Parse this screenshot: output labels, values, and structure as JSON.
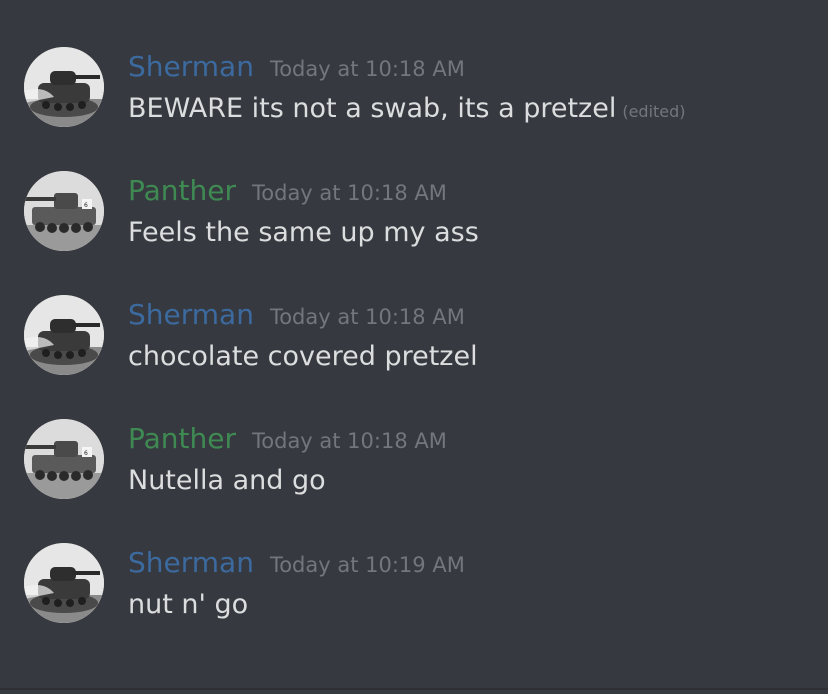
{
  "messages": [
    {
      "author": "Sherman",
      "time": "Today at 10:18 AM",
      "text": "BEWARE its not a swab, its a pretzel",
      "edited": "(edited)",
      "color": "#3c6a9e"
    },
    {
      "author": "Panther",
      "time": "Today at 10:18 AM",
      "text": "Feels the same up my ass",
      "color": "#3f8a52"
    },
    {
      "author": "Sherman",
      "time": "Today at 10:18 AM",
      "text": "chocolate covered pretzel",
      "color": "#3c6a9e"
    },
    {
      "author": "Panther",
      "time": "Today at 10:18 AM",
      "text": "Nutella and go",
      "color": "#3f8a52"
    },
    {
      "author": "Sherman",
      "time": "Today at 10:19 AM",
      "text": "nut n' go",
      "color": "#3c6a9e"
    }
  ],
  "colors": {
    "background": "#36393f",
    "timestamp": "#72767d",
    "message_text": "#dcddde"
  },
  "icons": {
    "sherman_avatar": "sherman-tank-avatar-icon",
    "panther_avatar": "panther-tank-avatar-icon"
  }
}
